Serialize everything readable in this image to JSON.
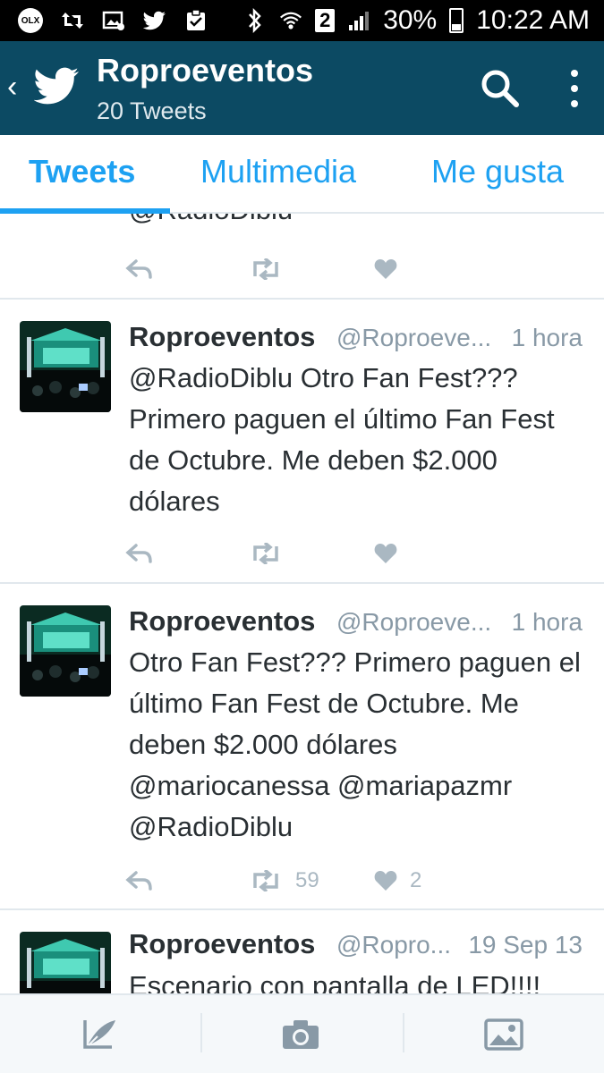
{
  "status_bar": {
    "battery": "30%",
    "time": "10:22 AM",
    "sim": "2",
    "left_icons": [
      "olx-icon",
      "retweet-notification-icon",
      "image-notification-icon",
      "twitter-bird-icon",
      "clipboard-check-icon"
    ],
    "olx_label": "OLX"
  },
  "header": {
    "title": "Roproeventos",
    "subtitle": "20 Tweets"
  },
  "tabs": [
    {
      "label": "Tweets",
      "active": true
    },
    {
      "label": "Multimedia",
      "active": false
    },
    {
      "label": "Me gusta",
      "active": false
    }
  ],
  "partial_tweet": {
    "text": "@RadioDiblu"
  },
  "tweets": [
    {
      "name": "Roproeventos",
      "handle": "@Roproeve...",
      "time": "1 hora",
      "text": "@RadioDiblu Otro Fan Fest??? Primero paguen el último Fan Fest de Octubre. Me deben $2.000 dólares",
      "retweets": "",
      "likes": ""
    },
    {
      "name": "Roproeventos",
      "handle": "@Roproeve...",
      "time": "1 hora",
      "text": "Otro Fan Fest??? Primero paguen el último Fan Fest de Octubre. Me deben $2.000 dólares @mariocanessa @mariapazmr @RadioDiblu",
      "retweets": "59",
      "likes": "2"
    },
    {
      "name": "Roproeventos",
      "handle": "@Ropro...",
      "time": "19 Sep 13",
      "text": "Escenario con pantalla de LED!!!!",
      "retweets": "",
      "likes": ""
    }
  ],
  "colors": {
    "app_bar": "#0c4a63",
    "accent": "#1da1f2",
    "muted": "#8899a6",
    "action_icons": "#aab8c2"
  }
}
